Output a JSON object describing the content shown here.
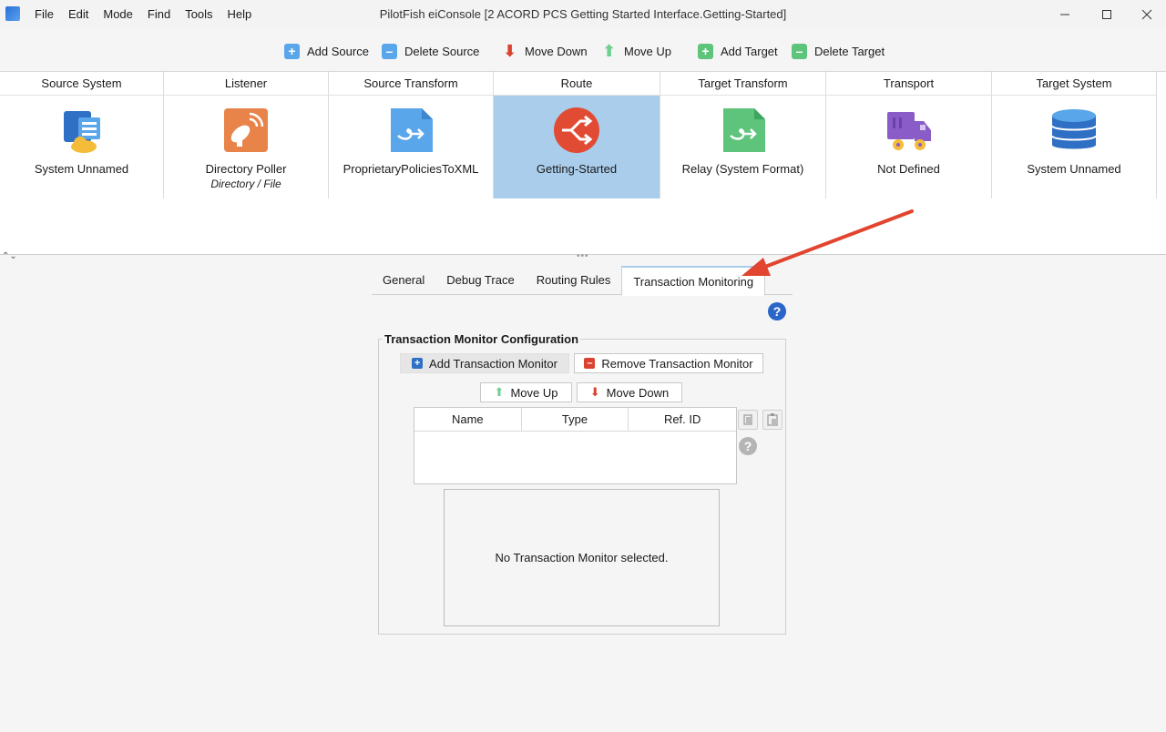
{
  "window": {
    "title": "PilotFish eiConsole [2 ACORD PCS Getting Started Interface.Getting-Started]",
    "menu": [
      "File",
      "Edit",
      "Mode",
      "Find",
      "Tools",
      "Help"
    ]
  },
  "toolbar": {
    "add_source": "Add Source",
    "delete_source": "Delete Source",
    "move_down": "Move Down",
    "move_up": "Move Up",
    "add_target": "Add Target",
    "delete_target": "Delete Target"
  },
  "pipeline": [
    {
      "header": "Source System",
      "label": "System Unnamed",
      "sub": "",
      "icon": "source-system-icon"
    },
    {
      "header": "Listener",
      "label": "Directory Poller",
      "sub": "Directory / File",
      "icon": "satellite-dish-icon"
    },
    {
      "header": "Source Transform",
      "label": "ProprietaryPoliciesToXML",
      "sub": "",
      "icon": "transform-document-icon"
    },
    {
      "header": "Route",
      "label": "Getting-Started",
      "sub": "",
      "icon": "route-icon"
    },
    {
      "header": "Target Transform",
      "label": "Relay (System Format)",
      "sub": "",
      "icon": "transform-document-icon"
    },
    {
      "header": "Transport",
      "label": "Not Defined",
      "sub": "",
      "icon": "truck-icon"
    },
    {
      "header": "Target System",
      "label": "System Unnamed",
      "sub": "",
      "icon": "database-icon"
    }
  ],
  "tabs": [
    "General",
    "Debug Trace",
    "Routing Rules",
    "Transaction Monitoring"
  ],
  "active_tab": "Transaction Monitoring",
  "monitor": {
    "group_title": "Transaction Monitor Configuration",
    "add_label": "Add Transaction Monitor",
    "remove_label": "Remove Transaction Monitor",
    "move_up": "Move Up",
    "move_down": "Move Down",
    "columns": [
      "Name",
      "Type",
      "Ref. ID"
    ],
    "rows": [],
    "empty_message": "No Transaction Monitor selected."
  },
  "colors": {
    "selected_stage": "#a9cdeb",
    "add_icon": "#5aa6ea",
    "delete_icon": "#5aa6ea",
    "down_arrow": "#d9432f",
    "up_arrow": "#6fcf8f",
    "target_add": "#5ec47c",
    "annotation_arrow": "#e2452f",
    "help_blue": "#2a66c9"
  }
}
